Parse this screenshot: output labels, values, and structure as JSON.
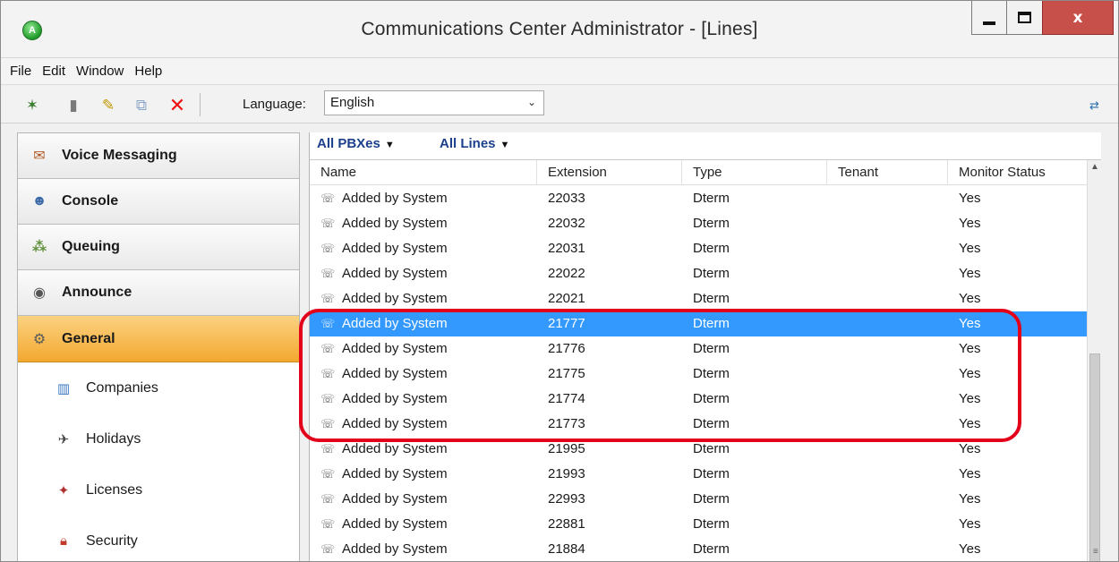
{
  "window": {
    "title": "Communications Center Administrator - [Lines]",
    "app_icon_letter": "A",
    "close_label": "x"
  },
  "menu": {
    "file": "File",
    "edit": "Edit",
    "window": "Window",
    "help": "Help"
  },
  "toolbar": {
    "language_label": "Language:",
    "language_value": "English"
  },
  "sidebar": {
    "nav": [
      {
        "label": "Voice Messaging",
        "icon": "voice-messaging-icon"
      },
      {
        "label": "Console",
        "icon": "console-icon"
      },
      {
        "label": "Queuing",
        "icon": "queuing-icon"
      },
      {
        "label": "Announce",
        "icon": "announce-icon"
      },
      {
        "label": "General",
        "icon": "general-icon",
        "active": true
      }
    ],
    "sub": [
      {
        "label": "Companies",
        "icon": "companies-icon"
      },
      {
        "label": "Holidays",
        "icon": "holidays-icon"
      },
      {
        "label": "Licenses",
        "icon": "licenses-icon"
      },
      {
        "label": "Security",
        "icon": "security-icon"
      }
    ]
  },
  "filters": {
    "pbx": "All PBXes",
    "lines": "All Lines"
  },
  "table": {
    "columns": [
      "Name",
      "Extension",
      "Type",
      "Tenant",
      "Monitor Status"
    ],
    "rows": [
      {
        "name": "Added by System",
        "ext": "22033",
        "type": "Dterm",
        "tenant": "",
        "status": "Yes"
      },
      {
        "name": "Added by System",
        "ext": "22032",
        "type": "Dterm",
        "tenant": "",
        "status": "Yes"
      },
      {
        "name": "Added by System",
        "ext": "22031",
        "type": "Dterm",
        "tenant": "",
        "status": "Yes"
      },
      {
        "name": "Added by System",
        "ext": "22022",
        "type": "Dterm",
        "tenant": "",
        "status": "Yes"
      },
      {
        "name": "Added by System",
        "ext": "22021",
        "type": "Dterm",
        "tenant": "",
        "status": "Yes"
      },
      {
        "name": "Added by System",
        "ext": "21777",
        "type": "Dterm",
        "tenant": "",
        "status": "Yes",
        "selected": true
      },
      {
        "name": "Added by System",
        "ext": "21776",
        "type": "Dterm",
        "tenant": "",
        "status": "Yes"
      },
      {
        "name": "Added by System",
        "ext": "21775",
        "type": "Dterm",
        "tenant": "",
        "status": "Yes"
      },
      {
        "name": "Added by System",
        "ext": "21774",
        "type": "Dterm",
        "tenant": "",
        "status": "Yes"
      },
      {
        "name": "Added by System",
        "ext": "21773",
        "type": "Dterm",
        "tenant": "",
        "status": "Yes"
      },
      {
        "name": "Added by System",
        "ext": "21995",
        "type": "Dterm",
        "tenant": "",
        "status": "Yes"
      },
      {
        "name": "Added by System",
        "ext": "21993",
        "type": "Dterm",
        "tenant": "",
        "status": "Yes"
      },
      {
        "name": "Added by System",
        "ext": "22993",
        "type": "Dterm",
        "tenant": "",
        "status": "Yes"
      },
      {
        "name": "Added by System",
        "ext": "22881",
        "type": "Dterm",
        "tenant": "",
        "status": "Yes"
      },
      {
        "name": "Added by System",
        "ext": "21884",
        "type": "Dterm",
        "tenant": "",
        "status": "Yes"
      }
    ]
  },
  "colors": {
    "selection": "#3399ff",
    "active_nav": "#f3a82f",
    "highlight": "#e3001b",
    "close_button": "#c7504a"
  }
}
